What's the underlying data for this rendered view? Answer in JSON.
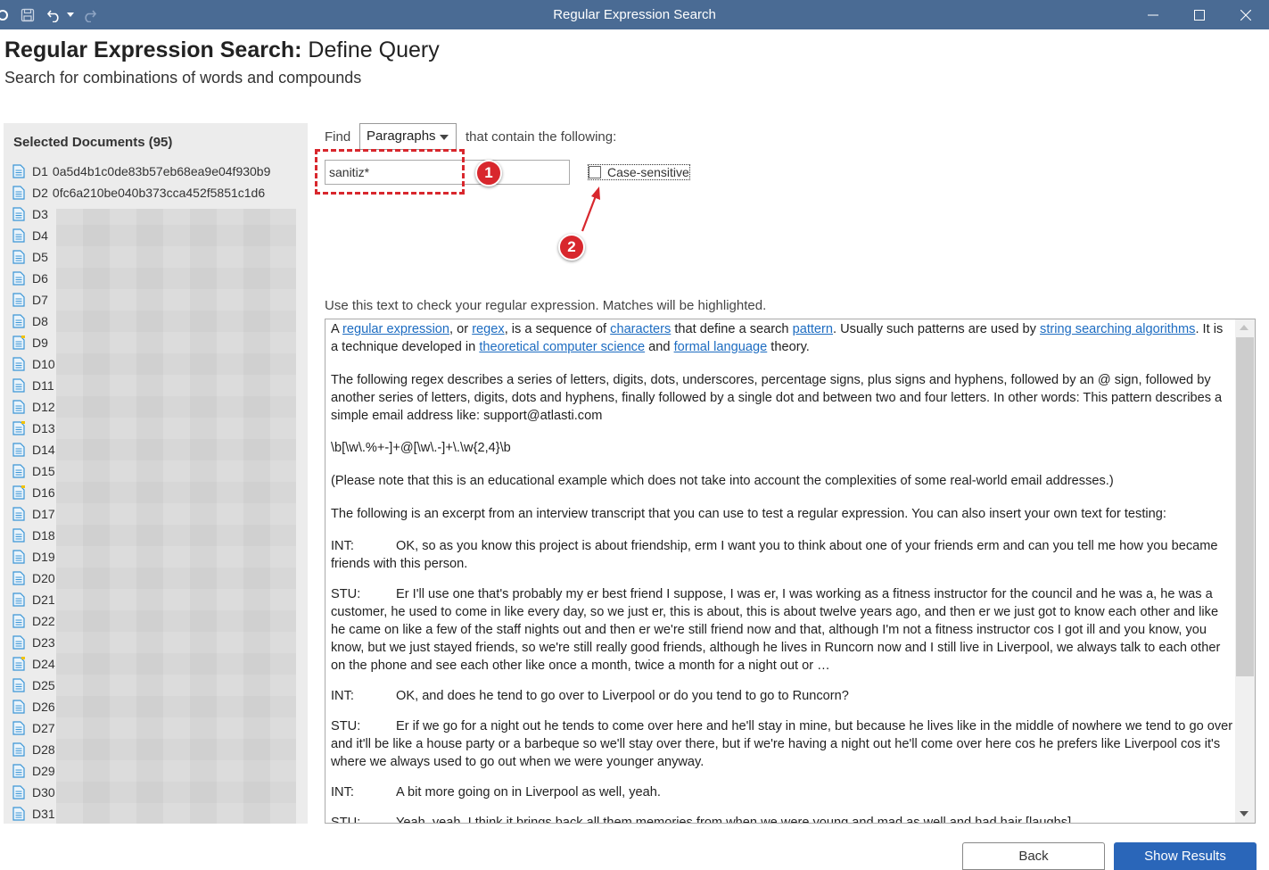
{
  "window": {
    "title": "Regular Expression Search",
    "controls": [
      "minimize",
      "maximize",
      "close"
    ]
  },
  "toolbar": {
    "icons": [
      "circle-icon",
      "save-icon",
      "undo-icon",
      "undo-dropdown-icon",
      "redo-icon"
    ]
  },
  "header": {
    "title_bold": "Regular Expression Search:",
    "title_rest": " Define Query",
    "subtitle": "Search for combinations of words and compounds"
  },
  "sidebar": {
    "title": "Selected Documents (95)",
    "items": [
      {
        "id": "D1",
        "name": "0a5d4b1c0de83b57eb68ea9e04f930b9",
        "icon_variant": "doc"
      },
      {
        "id": "D2",
        "name": "0fc6a210be040b373cca452f5851c1d6",
        "icon_variant": "doc"
      },
      {
        "id": "D3",
        "name": "",
        "icon_variant": "doc"
      },
      {
        "id": "D4",
        "name": "",
        "icon_variant": "doc"
      },
      {
        "id": "D5",
        "name": "",
        "icon_variant": "doc"
      },
      {
        "id": "D6",
        "name": "",
        "icon_variant": "doc"
      },
      {
        "id": "D7",
        "name": "",
        "icon_variant": "doc"
      },
      {
        "id": "D8",
        "name": "",
        "icon_variant": "doc"
      },
      {
        "id": "D9",
        "name": "",
        "icon_variant": "doc-flag"
      },
      {
        "id": "D10",
        "name": "",
        "icon_variant": "doc"
      },
      {
        "id": "D11",
        "name": "",
        "icon_variant": "doc"
      },
      {
        "id": "D12",
        "name": "",
        "icon_variant": "doc"
      },
      {
        "id": "D13",
        "name": "",
        "icon_variant": "doc-flag"
      },
      {
        "id": "D14",
        "name": "",
        "icon_variant": "doc"
      },
      {
        "id": "D15",
        "name": "",
        "icon_variant": "doc"
      },
      {
        "id": "D16",
        "name": "",
        "icon_variant": "doc-flag"
      },
      {
        "id": "D17",
        "name": "",
        "icon_variant": "doc"
      },
      {
        "id": "D18",
        "name": "",
        "icon_variant": "doc"
      },
      {
        "id": "D19",
        "name": "",
        "icon_variant": "doc"
      },
      {
        "id": "D20",
        "name": "",
        "icon_variant": "doc"
      },
      {
        "id": "D21",
        "name": "",
        "icon_variant": "doc"
      },
      {
        "id": "D22",
        "name": "",
        "icon_variant": "doc"
      },
      {
        "id": "D23",
        "name": "",
        "icon_variant": "doc"
      },
      {
        "id": "D24",
        "name": "",
        "icon_variant": "doc-flag"
      },
      {
        "id": "D25",
        "name": "",
        "icon_variant": "doc"
      },
      {
        "id": "D26",
        "name": "",
        "icon_variant": "doc"
      },
      {
        "id": "D27",
        "name": "",
        "icon_variant": "doc"
      },
      {
        "id": "D28",
        "name": "",
        "icon_variant": "doc"
      },
      {
        "id": "D29",
        "name": "",
        "icon_variant": "doc"
      },
      {
        "id": "D30",
        "name": "",
        "icon_variant": "doc"
      },
      {
        "id": "D31",
        "name": "",
        "icon_variant": "doc"
      }
    ]
  },
  "query": {
    "find_label": "Find",
    "scope_selected": "Paragraphs",
    "contain_label": "that contain the following:",
    "input_value": "sanitiz*",
    "case_sensitive_label": "Case-sensitive",
    "case_sensitive_checked": false
  },
  "annotations": {
    "badge1": "1",
    "badge2": "2",
    "accent_color": "#d8272d"
  },
  "check_text": {
    "label": "Use this text to check your regular expression. Matches will be highlighted.",
    "p1": {
      "t1": "A ",
      "l1": "regular expression",
      "t2": ", or ",
      "l2": "regex",
      "t3": ", is a sequence of ",
      "l3": "characters",
      "t4": " that define a search ",
      "l4": "pattern",
      "t5": ". Usually such patterns are used by ",
      "l5": "string searching algorithms",
      "t6": ". It is a technique developed in ",
      "l6": "theoretical computer science",
      "t7": " and ",
      "l7": "formal language",
      "t8": " theory."
    },
    "p2": "The following regex describes a series of letters, digits, dots, underscores, percentage signs, plus signs and hyphens, followed by an @ sign, followed by another series of letters, digits, dots and hyphens, finally followed by a single dot and between two and four letters. In other words: This pattern describes a simple email address like: support@atlasti.com",
    "p3": "\\b[\\w\\.%+-]+@[\\w\\.-]+\\.\\w{2,4}\\b",
    "p4": "(Please note that this is an educational example which does not take into account the complexities of some real-world email addresses.)",
    "p5": "The following is an excerpt from an interview transcript that you can use to test a regular expression. You can also insert your own text for testing:",
    "transcript": [
      {
        "speaker": "INT:",
        "text": "OK, so as you know this project is about friendship, erm I want you to think about one of your friends erm and can you tell me how you became friends with this person."
      },
      {
        "speaker": "STU:",
        "text": "Er I'll use one that's probably my er best friend I suppose, I was er, I was working as a fitness instructor for the council and he was a, he was a customer, he used to come in like every day, so we just er, this is about, this is about twelve years ago, and then er we just got to know each other and like he came on like a few of the staff nights out and then er we're still friend now and that, although I'm not a fitness instructor cos I got ill and you know, you know, but we just stayed friends, so we're still really good friends, although he lives in Runcorn now and I still live in Liverpool, we always talk to each other on the phone and see each other like once a month, twice a month for a night out or …"
      },
      {
        "speaker": "INT:",
        "text": "OK, and does he tend to go over to Liverpool or do you tend to go to Runcorn?"
      },
      {
        "speaker": "STU:",
        "text": "Er if we go for a night out he tends to come over here and he'll stay in mine, but because he lives like in the middle of nowhere we tend to go over and it'll be like a house party or a barbeque so we'll stay over there, but if we're having a night out he'll come over here cos he prefers like Liverpool cos it's where we always used to go out when we were younger anyway."
      },
      {
        "speaker": "INT:",
        "text": "A bit more going on in Liverpool as well, yeah."
      },
      {
        "speaker": "STU:",
        "text": "Yeah, yeah, I think it brings back all them memories from when we were young and mad as well and had hair [laughs]."
      }
    ]
  },
  "buttons": {
    "back": "Back",
    "show_results": "Show Results"
  }
}
